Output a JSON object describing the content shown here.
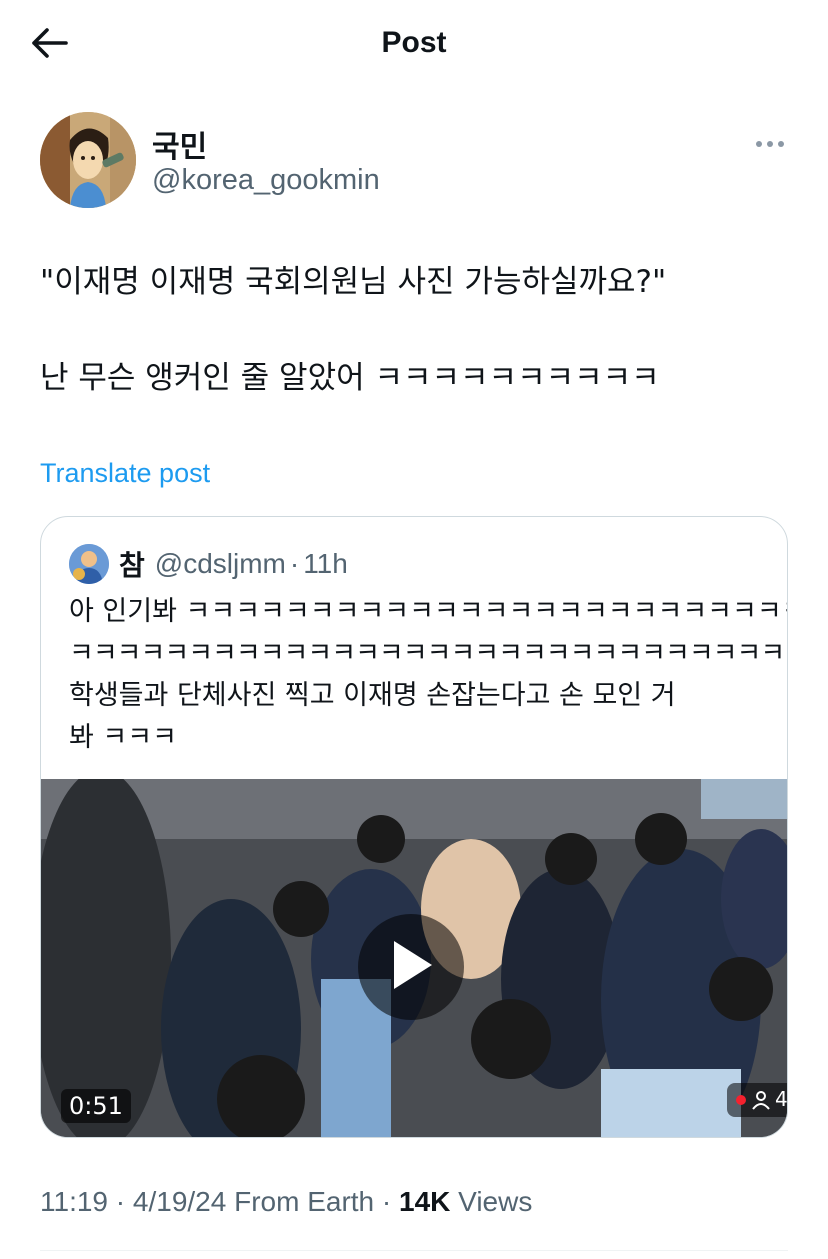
{
  "header": {
    "title": "Post",
    "back_icon": "arrow-left-icon"
  },
  "post": {
    "author": {
      "display_name": "국민",
      "handle": "@korea_gookmin"
    },
    "text_lines": [
      "\"이재명 이재명 국회의원님 사진 가능하실까요?\"",
      "난 무슨 앵커인 줄 알았어 ㅋㅋㅋㅋㅋㅋㅋㅋㅋㅋ"
    ],
    "translate_label": "Translate post",
    "quoted": {
      "display_name": "참",
      "handle": "@cdsljmm",
      "separator": "·",
      "time": "11h",
      "text_lines": [
        "아 인기봐 ㅋㅋㅋㅋㅋㅋㅋㅋㅋㅋㅋㅋㅋㅋㅋㅋㅋㅋㅋㅋㅋㅋㅋㅋㅋㅋ",
        "ㅋㅋㅋㅋㅋㅋㅋㅋㅋㅋㅋㅋㅋㅋㅋㅋㅋㅋㅋㅋㅋㅋㅋㅋㅋㅋㅋㅋㅋㅋㅋㅋㅋ",
        "학생들과 단체사진 찍고 이재명 손잡는다고 손 모인 거",
        "봐 ㅋㅋㅋ"
      ],
      "video": {
        "duration": "0:51",
        "play_icon": "play-icon",
        "viewer_count": "4"
      }
    },
    "meta": {
      "time": "11:19",
      "sep1": " · ",
      "date": "4/19/24",
      "source": " From Earth",
      "sep2": " · ",
      "views_count": "14K",
      "views_label": " Views"
    }
  },
  "colors": {
    "accent": "#1d9bf0",
    "secondary_text": "#536471",
    "border": "#cfd9de"
  }
}
